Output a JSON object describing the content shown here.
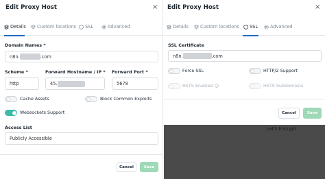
{
  "left": {
    "title": "Edit Proxy Host",
    "close": "×",
    "tabs": [
      {
        "label": "Details",
        "icon": "details-icon"
      },
      {
        "label": "Custom locations",
        "icon": "layers-icon"
      },
      {
        "label": "SSL",
        "icon": "shield-icon"
      },
      {
        "label": "Advanced",
        "icon": "gear-icon"
      }
    ],
    "domain_label": "Domain Names *",
    "domain_prefix": "n8n.",
    "domain_suffix": ".com",
    "scheme_label": "Scheme *",
    "scheme_value": "http",
    "hostname_label": "Forward Hostname / IP *",
    "hostname_prefix": "45.",
    "port_label": "Forward Port *",
    "port_value": "5678",
    "cache_assets": "Cache Assets",
    "block_exploits": "Block Common Exploits",
    "websockets": "Websockets Support",
    "access_list_label": "Access List",
    "access_list_value": "Publicly Accessible",
    "cancel": "Cancel",
    "save": "Save"
  },
  "right": {
    "title": "Edit Proxy Host",
    "close": "×",
    "tabs": [
      {
        "label": "Details",
        "icon": "details-icon"
      },
      {
        "label": "Custom locations",
        "icon": "layers-icon"
      },
      {
        "label": "SSL",
        "icon": "shield-icon"
      },
      {
        "label": "Advanced",
        "icon": "gear-icon"
      }
    ],
    "ssl_cert_label": "SSL Certificate",
    "ssl_prefix": "n8n.",
    "ssl_suffix": ".com",
    "force_ssl": "Force SSL",
    "http2": "HTTP/2 Support",
    "hsts_enabled": "HSTS Enabled",
    "hsts_subdomains": "HSTS Subdomains",
    "cancel": "Cancel",
    "save": "Save",
    "letsencrypt": "Let's Encrypt"
  },
  "colors": {
    "toggle_on": "#3cb9a8",
    "save_button": "#9fd9b7",
    "tab_active": "#206bc4"
  }
}
